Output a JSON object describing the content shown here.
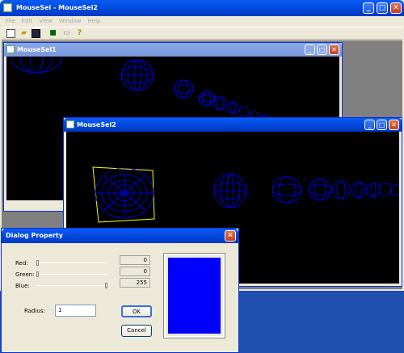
{
  "main_window": {
    "title": "MouseSel - MouseSel2",
    "menu": [
      "File",
      "Edit",
      "View",
      "Window",
      "Help"
    ],
    "toolbar": [
      "new-icon",
      "open-icon",
      "save-icon",
      "db-icon",
      "print-icon",
      "help-icon"
    ]
  },
  "child1": {
    "title": "MouseSel1"
  },
  "child2": {
    "title": "MouseSel2"
  },
  "dialog": {
    "title": "Dialog Property",
    "red_label": "Red:",
    "green_label": "Green:",
    "blue_label": "Blue:",
    "red_value": "0",
    "green_value": "0",
    "blue_value": "255",
    "red_level": 0,
    "green_level": 0,
    "blue_level": 1.0,
    "radius_label": "Radius:",
    "radius_value": "1",
    "ok_label": "OK",
    "cancel_label": "Cancel",
    "preview_color": "#0000ff"
  },
  "colors": {
    "wireframe": "#0000ff",
    "selection": "#ffff00",
    "canvas": "#000000"
  }
}
